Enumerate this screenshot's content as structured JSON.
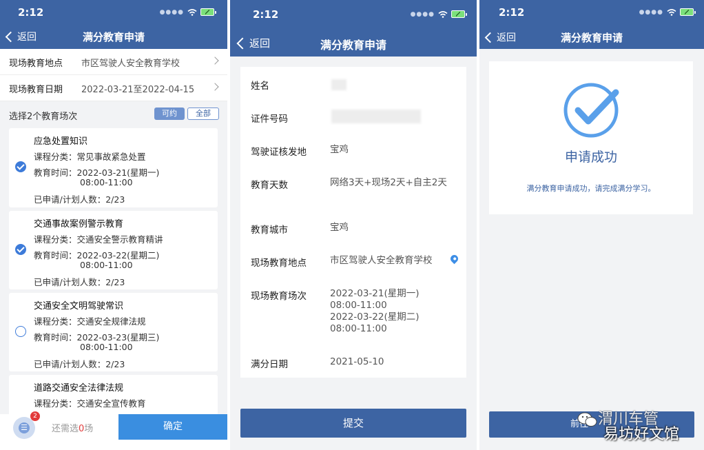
{
  "status": {
    "time": "2:12"
  },
  "nav": {
    "back": "返回",
    "title": "满分教育申请"
  },
  "panel1": {
    "location_label": "现场教育地点",
    "location_value": "市区驾驶人安全教育学校",
    "date_label": "现场教育日期",
    "date_value": "2022-03-21至2022-04-15",
    "select_hint": "选择2个教育场次",
    "filter_available": "可约",
    "filter_all": "全部",
    "sessions": [
      {
        "name": "应急处置知识",
        "category": "课程分类：常见事故紧急处置",
        "time1": "教育时间：2022-03-21(星期一)",
        "time2": "08:00-11:00",
        "count": "已申请/计划人数：2/23",
        "selected": true
      },
      {
        "name": "交通事故案例警示教育",
        "category": "课程分类：交通安全警示教育精讲",
        "time1": "教育时间：2022-03-22(星期二)",
        "time2": "08:00-11:00",
        "count": "已申请/计划人数：2/23",
        "selected": true
      },
      {
        "name": "交通安全文明驾驶常识",
        "category": "课程分类：交通安全规律法规",
        "time1": "教育时间：2022-03-23(星期三)",
        "time2": "08:00-11:00",
        "count": "已申请/计划人数：2/23",
        "selected": false
      },
      {
        "name": "道路交通安全法律法规",
        "category": "课程分类：交通安全宣传教育",
        "time1": "",
        "time2": "",
        "count": "",
        "selected": false
      }
    ],
    "cart_badge": "2",
    "cart_icon": "list-icon",
    "remain_prefix": "还需选",
    "remain_count": "0",
    "remain_suffix": "场",
    "confirm": "确定"
  },
  "panel2": {
    "name_label": "姓名",
    "id_label": "证件号码",
    "license_label": "驾驶证核发地",
    "license_value": "宝鸡",
    "days_label": "教育天数",
    "days_value": "网络3天+现场2天+自主2天",
    "city_label": "教育城市",
    "city_value": "宝鸡",
    "place_label": "现场教育地点",
    "place_value": "市区驾驶人安全教育学校",
    "sessions_label": "现场教育场次",
    "session_lines": [
      "2022-03-21(星期一)",
      "08:00-11:00",
      "2022-03-22(星期二)",
      "08:00-11:00"
    ],
    "full_date_label": "满分日期",
    "full_date_value": "2021-05-10",
    "submit": "提交"
  },
  "panel3": {
    "success_title": "申请成功",
    "success_msg": "满分教育申请成功，请完成满分学习。",
    "goto_prefix": "前往",
    "watermark_line1": "渭川车管",
    "watermark_line2": "易坊好文馆"
  },
  "colors": {
    "nav": "#3d64a3",
    "accent": "#3d7bd9",
    "confirm": "#3a8ee0",
    "badge": "#e23b3b"
  }
}
